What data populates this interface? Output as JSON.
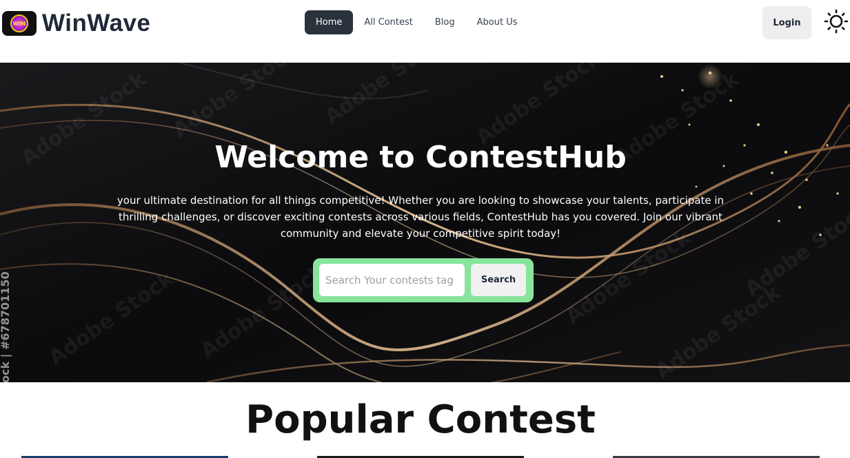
{
  "brand": {
    "name": "WinWave",
    "logo_text": "WIN",
    "logo_icon": "trophy-logo"
  },
  "nav": {
    "links": [
      {
        "label": "Home",
        "active": true
      },
      {
        "label": "All Contest",
        "active": false
      },
      {
        "label": "Blog",
        "active": false
      },
      {
        "label": "About Us",
        "active": false
      }
    ],
    "login_label": "Login",
    "theme_icon": "sun-icon"
  },
  "hero": {
    "title": "Welcome to ContestHub",
    "description": "your ultimate destination for all things competitive! Whether you are looking to showcase your talents, participate in thrilling challenges, or discover exciting contests across various fields, ContestHub has you covered. Join our vibrant community and elevate your competitive spirit today!",
    "watermark": "Adobe Stock",
    "side_watermark": "ock | #678701150",
    "search": {
      "placeholder": "Search Your contests tag",
      "button_label": "Search"
    }
  },
  "popular": {
    "title": "Popular Contest"
  },
  "colors": {
    "nav_active": "#2a323c",
    "search_frame": "#86e59a",
    "hero_bg": "#0a0a0c",
    "accent_gold": "#d9a06a"
  }
}
